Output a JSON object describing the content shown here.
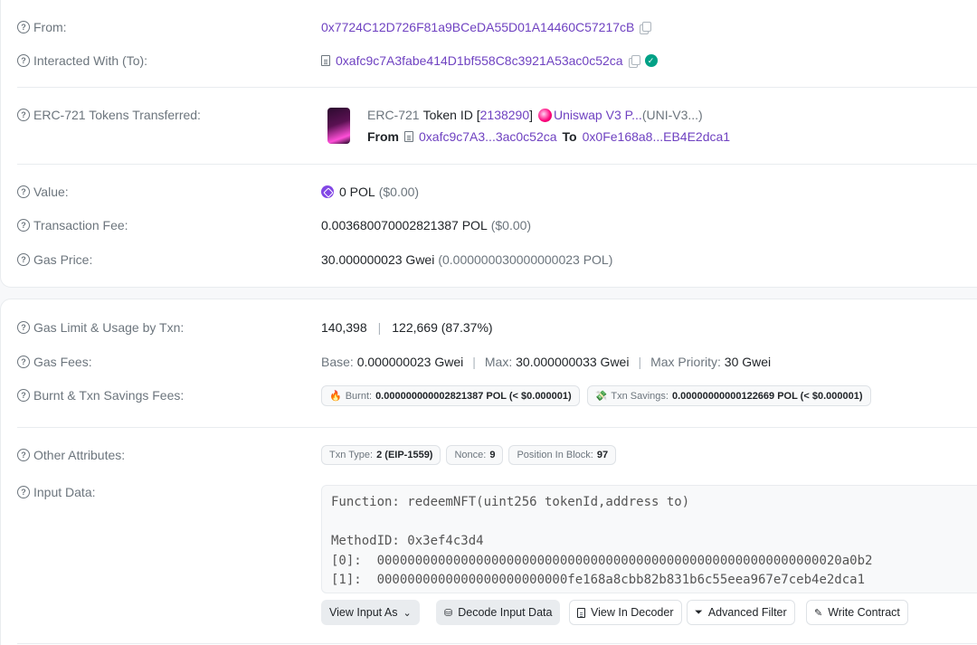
{
  "overview": {
    "from": {
      "label": "From:",
      "address": "0x7724C12D726F81a9BCeDA55D01A14460C57217cB"
    },
    "to": {
      "label": "Interacted With (To):",
      "address": "0xafc9c7A3fabe414D1bf558C8c3921A53ac0c52ca"
    },
    "token_transfer": {
      "label": "ERC-721 Tokens Transferred:",
      "standard": "ERC-721",
      "token_id_label": "Token ID",
      "token_id": "2138290",
      "token_name": "Uniswap V3 P...",
      "token_symbol": "(UNI-V3...)",
      "from_label": "From",
      "from_address": "0xafc9c7A3...3ac0c52ca",
      "to_label": "To",
      "to_address": "0x0Fe168a8...EB4E2dca1"
    },
    "value": {
      "label": "Value:",
      "amount": "0 POL",
      "usd": "($0.00)"
    },
    "fee": {
      "label": "Transaction Fee:",
      "amount": "0.003680070002821387 POL",
      "usd": "($0.00)"
    },
    "gas_price": {
      "label": "Gas Price:",
      "gwei": "30.000000023 Gwei",
      "pol": "(0.000000030000000023 POL)"
    }
  },
  "more": {
    "gas_limit": {
      "label": "Gas Limit & Usage by Txn:",
      "limit": "140,398",
      "usage": "122,669 (87.37%)"
    },
    "gas_fees": {
      "label": "Gas Fees:",
      "base_label": "Base:",
      "base": "0.000000023 Gwei",
      "max_label": "Max:",
      "max": "30.000000033 Gwei",
      "priority_label": "Max Priority:",
      "priority": "30 Gwei"
    },
    "burnt": {
      "label": "Burnt & Txn Savings Fees:",
      "burnt_label": "Burnt:",
      "burnt_value": "0.000000000002821387 POL (< $0.000001)",
      "savings_label": "Txn Savings:",
      "savings_value": "0.00000000000122669 POL (< $0.000001)"
    },
    "attributes": {
      "label": "Other Attributes:",
      "txn_type_label": "Txn Type:",
      "txn_type": "2 (EIP-1559)",
      "nonce_label": "Nonce:",
      "nonce": "9",
      "position_label": "Position In Block:",
      "position": "97"
    },
    "input": {
      "label": "Input Data:",
      "text": "Function: redeemNFT(uint256 tokenId,address to)\n\nMethodID: 0x3ef4c3d4\n[0]:  0000000000000000000000000000000000000000000000000000000000020a0b2\n[1]:  0000000000000000000000000fe168a8cbb82b831b6c55eea967e7ceb4e2dca1",
      "buttons": {
        "view_as": "View Input As",
        "decode": "Decode Input Data",
        "decoder": "View In Decoder",
        "filter": "Advanced Filter",
        "write": "Write Contract"
      }
    }
  },
  "colors": {
    "link": "#6f42c1",
    "verified": "#00a186",
    "muted": "#6c757d"
  }
}
